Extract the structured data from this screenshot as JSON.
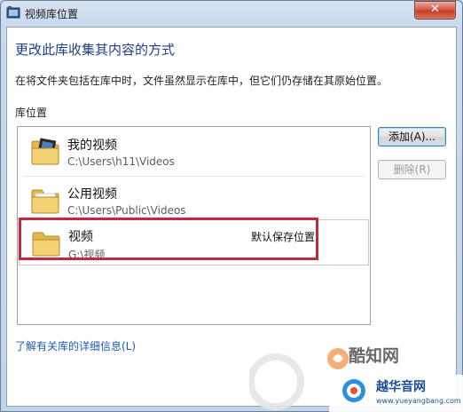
{
  "window": {
    "title": "视频库位置",
    "close_label": "✕"
  },
  "main": {
    "heading": "更改此库收集其内容的方式",
    "description": "在将文件夹包括在库中时，文件虽然显示在库中，但它们仍存储在其原始位置。",
    "section_label": "库位置",
    "locations": [
      {
        "name": "我的视频",
        "path": "C:\\Users\\h11\\Videos",
        "tag": ""
      },
      {
        "name": "公用视频",
        "path": "C:\\Users\\Public\\Videos",
        "tag": ""
      },
      {
        "name": "视频",
        "path": "G:\\视频",
        "tag": "默认保存位置"
      }
    ],
    "add_button": "添加(A)...",
    "remove_button": "删除(R)",
    "info_link": "了解有关库的详细信息(L)"
  },
  "watermarks": {
    "brand1": "酷知网",
    "brand2": "越华音网",
    "brand2_url": "www.yueyangbang.com"
  },
  "colors": {
    "heading": "#1e3f8a",
    "link": "#1c5bb6",
    "highlight": "#c5283c",
    "folder": "#e8c25a"
  }
}
